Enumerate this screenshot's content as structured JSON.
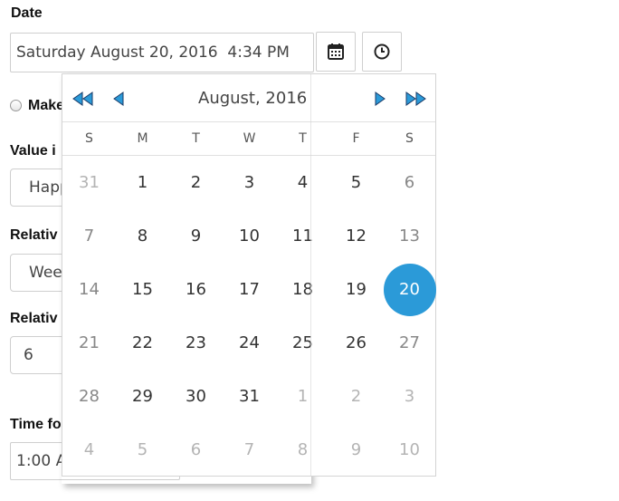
{
  "form": {
    "date_label": "Date",
    "date_value": "Saturday August 20, 2016  4:34 PM",
    "make_label": "Make",
    "value_label": "Value i",
    "value_field": "Happ",
    "relative1_label": "Relativ",
    "relative1_field": "Wee",
    "relative2_label": "Relativ",
    "relative2_field": "6",
    "time_label": "Time fo",
    "time_field": "1:00 AI"
  },
  "icons": {
    "calendar_button": "calendar-icon",
    "clock_button": "clock-icon"
  },
  "calendar": {
    "title": "August, 2016",
    "weekdays": [
      "S",
      "M",
      "T",
      "W",
      "T",
      "F",
      "S"
    ],
    "weeks": [
      [
        "31",
        "1",
        "2",
        "3",
        "4",
        "5",
        "6"
      ],
      [
        "7",
        "8",
        "9",
        "10",
        "11",
        "12",
        "13"
      ],
      [
        "14",
        "15",
        "16",
        "17",
        "18",
        "19",
        "20"
      ],
      [
        "21",
        "22",
        "23",
        "24",
        "25",
        "26",
        "27"
      ],
      [
        "28",
        "29",
        "30",
        "31",
        "1",
        "2",
        "3"
      ],
      [
        "4",
        "5",
        "6",
        "7",
        "8",
        "9",
        "10"
      ]
    ],
    "selected": "20",
    "accent_color": "#2b9ad8",
    "nav_icons": [
      "double-left-arrow-icon",
      "left-arrow-icon",
      "right-arrow-icon",
      "double-right-arrow-icon"
    ]
  }
}
